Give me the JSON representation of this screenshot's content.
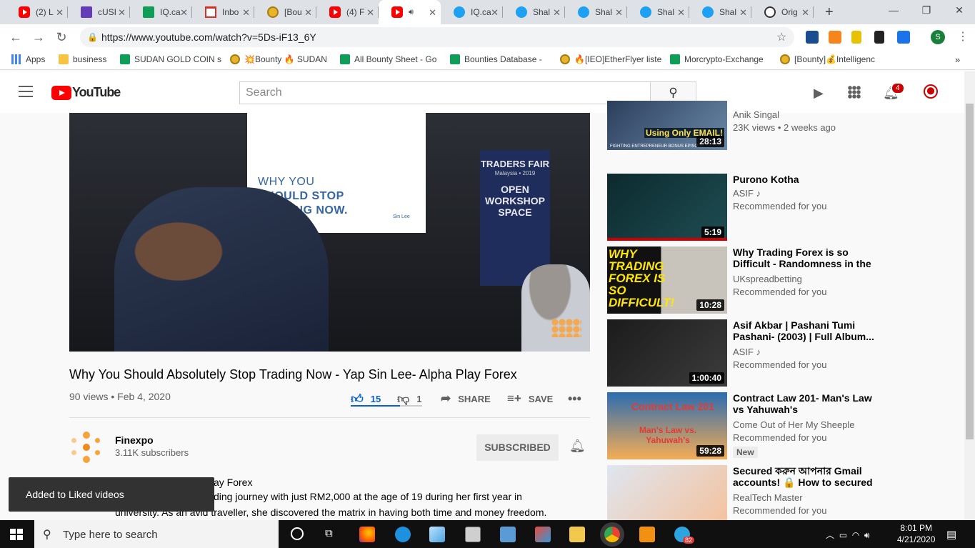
{
  "browser": {
    "tabs": [
      {
        "label": "(2) L",
        "icon": "youtube-icon"
      },
      {
        "label": "cUSI",
        "icon": "form-icon"
      },
      {
        "label": "IQ.ca",
        "icon": "sheets-icon"
      },
      {
        "label": "Inbo",
        "icon": "gmail-icon"
      },
      {
        "label": "[Bou",
        "icon": "bitcointalk-icon"
      },
      {
        "label": "(4) F",
        "icon": "youtube-icon"
      },
      {
        "label": "",
        "icon": "youtube-icon",
        "active": true
      },
      {
        "label": "IQ.ca",
        "icon": "twitter-icon"
      },
      {
        "label": "Shal",
        "icon": "twitter-icon"
      },
      {
        "label": "Shal",
        "icon": "twitter-icon"
      },
      {
        "label": "Shal",
        "icon": "twitter-icon"
      },
      {
        "label": "Shal",
        "icon": "twitter-icon"
      },
      {
        "label": "Orig",
        "icon": "origin-icon"
      }
    ],
    "url": "https://www.youtube.com/watch?v=5Ds-iF13_6Y",
    "profile_initial": "S",
    "bookmarks": [
      {
        "label": "Apps",
        "icon": "apps-icon"
      },
      {
        "label": "business",
        "icon": "folder-icon"
      },
      {
        "label": "SUDAN GOLD COIN s",
        "icon": "sheets-icon"
      },
      {
        "label": "💥Bounty 🔥 SUDAN",
        "icon": "bitcointalk-icon"
      },
      {
        "label": "All Bounty Sheet - Go",
        "icon": "sheets-icon"
      },
      {
        "label": "Bounties Database - ",
        "icon": "sheets-icon"
      },
      {
        "label": "🔥[IEO]EtherFlyer liste",
        "icon": "bitcointalk-icon"
      },
      {
        "label": "Morcrypto-Exchange",
        "icon": "sheets-icon"
      },
      {
        "label": "[Bounty]💰Intelligenc",
        "icon": "bitcointalk-icon"
      }
    ],
    "bookmarks_more": "»"
  },
  "youtube": {
    "logo_text": "YouTube",
    "search_placeholder": "Search",
    "notification_count": "4",
    "video": {
      "screen_lines": [
        "WHY YOU",
        "SHOULD STOP",
        "TRADING NOW."
      ],
      "screen_credit": "Sin Lee",
      "banner_title": "TRADERS FAIR",
      "banner_sub": "Malaysia • 2019",
      "banner_words": [
        "OPEN",
        "WORKSHOP",
        "SPACE"
      ],
      "title": "Why You Should Absolutely Stop Trading Now - Yap Sin Lee- Alpha Play Forex",
      "views": "90 views",
      "date": "Feb 4, 2020",
      "likes": "15",
      "dislikes": "1",
      "share_label": "SHARE",
      "save_label": "SAVE"
    },
    "channel": {
      "name": "Finexpo",
      "subscribers": "3.11K subscribers",
      "subscribe_label": "SUBSCRIBED"
    },
    "description": {
      "line1": "ay Forex",
      "line2": "ding journey with just RM2,000 at the age of 19 during her first year in",
      "line3": "university. As an avid traveller, she discovered the matrix in having both time and money freedom."
    },
    "toast": "Added to Liked videos",
    "recommendations": [
      {
        "title": "",
        "channel": "Anik Singal",
        "meta": "23K views • 2 weeks ago",
        "duration": "28:13",
        "thumb_text": "Using Only EMAIL!",
        "thumb_sub": "FIGHTING ENTREPRENEUR BONUS EPISODE"
      },
      {
        "title": "Purono Kotha",
        "channel": "ASIF ♪",
        "meta": "Recommended for you",
        "duration": "5:19"
      },
      {
        "title": "Why Trading Forex is so Difficult - Randomness in the Markets:...",
        "channel": "UKspreadbetting",
        "meta": "Recommended for you",
        "duration": "10:28",
        "thumb_text": "WHY TRADING FOREX IS SO DIFFICULT!"
      },
      {
        "title": "Asif Akbar | Pashani Tumi Pashani- (2003) | Full Album...",
        "channel": "ASIF ♪",
        "meta": "Recommended for you",
        "duration": "1:00:40"
      },
      {
        "title": "Contract Law 201- Man's Law vs Yahuwah's",
        "channel": "Come Out of Her My Sheeple",
        "meta": "Recommended for you",
        "duration": "59:28",
        "badge": "New",
        "thumb_text": "Contract Law 201",
        "thumb_sub": "Man's Law vs. Yahuwah's"
      },
      {
        "title": "Secured করুন আপনার Gmail accounts! 🔒 How to secured ...",
        "channel": "RealTech Master",
        "meta": "Recommended for you",
        "duration": ""
      }
    ]
  },
  "taskbar": {
    "search_placeholder": "Type here to search",
    "time": "8:01 PM",
    "date": "4/21/2020",
    "telegram_badge": "82"
  }
}
